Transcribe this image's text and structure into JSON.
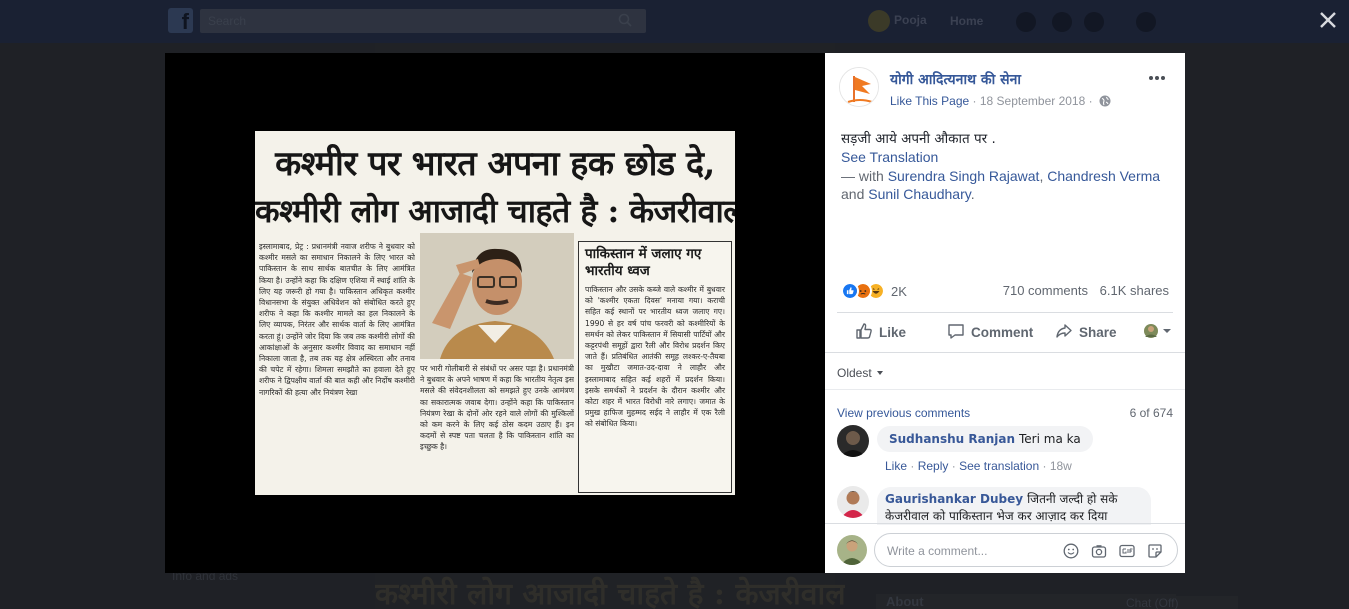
{
  "background": {
    "search_placeholder": "Search",
    "user_name": "Pooja",
    "home_label": "Home",
    "headline_bottom": "कश्मीरी लोग आजादी चाहते है : केजरीवाल",
    "left_snippet": "Info and ads",
    "about_label": "About",
    "chat_label": "Chat (Off)"
  },
  "photo": {
    "headline_line1": "कश्मीर पर भारत अपना हक छोड दे,",
    "headline_line2": "कश्मीरी लोग आजादी चाहते है : केजरीवाल",
    "col1_text": "इस्लामाबाद, प्रेट्र : प्रधानमंत्री नवाज शरीफ ने बुधवार को कश्मीर मसले का समाधान निकालने के लिए भारत को पाकिस्तान के साथ सार्थक बातचीत के लिए आमंत्रित किया है। उन्होंने कहा कि दक्षिण एशिया में स्थाई शांति के लिए यह जरूरी हो गया है। पाकिस्तान अधिकृत कश्मीर विधानसभा के संयुक्त अधिवेशन को संबोधित करते हुए शरीफ ने कहा कि कश्मीर मामले का हल निकालने के लिए व्यापक, निरंतर और सार्थक वार्ता के लिए आमंत्रित करता हूं। उन्होंने जोर दिया कि जब तक कश्मीरी लोगों की आकांक्षाओं के अनुसार कश्मीर विवाद का समाधान नहीं निकाला जाता है, तब तक यह क्षेत्र अस्थिरता और तनाव की चपेट में रहेगा। शिमला समझौते का हवाला देते हुए शरीफ ने द्विपक्षीय वार्ता की बात कही और निर्दोष कश्मीरी नागरिकों की हत्या और नियंत्रण रेखा",
    "col2_text": "पर भारी गोलीबारी से संबंधों पर असर पड़ा है। प्रधानमंत्री ने बुधवार के अपने भाषण में कहा कि भारतीय नेतृत्व इस मसले की संवेदनशीलता को समझते हुए उनके आमंत्रण का सकारात्मक जवाब देगा। उन्होंने कहा कि पाकिस्तान नियंत्रण रेखा के दोनों ओर रहने वाले लोगों की मुश्किलों को कम करने के लिए कई ठोस कदम उठाए हैं। इन कदमों से स्पष्ट पता चलता है कि पाकिस्तान शांति का इच्छुक है।",
    "box_title": "पाकिस्तान में जलाए गए भारतीय ध्वज",
    "box_text": "पाकिस्तान और उसके कब्जे वाले कश्मीर में बुधवार को 'कश्मीर एकता दिवस' मनाया गया। कराची सहित कई स्थानों पर भारतीय ध्वज जलाए गए। 1990 से हर वर्ष पांच फरवरी को कश्मीरियों के समर्थन को लेकर पाकिस्तान में सियासी पार्टियों और कट्टरपंथी समूहों द्वारा रैली और विरोध प्रदर्शन किए जाते हैं। प्रतिबंधित आतंकी समूह लश्कर-ए-तैयबा का मुखौटा जमात-उद-दावा ने लाहौर और इस्लामाबाद सहित कई शहरों में प्रदर्शन किया। इसके समर्थकों ने प्रदर्शन के दौरान कश्मीर और कोटा शहर में भारत विरोधी नारे लगाए। जमात के प्रमुख हाफिज मुहम्मद सईद ने लाहौर में एक रैली को संबोधित किया।"
  },
  "post": {
    "page_name": "योगी आदित्यनाथ की सेना",
    "like_page": "Like This Page",
    "separator": "·",
    "date": "18 September 2018",
    "separator2": "·",
    "text": "सड़जी आये अपनी औकात पर .",
    "see_translation": "See Translation",
    "with_prefix": "— with",
    "tag1": "Surendra Singh Rajawat",
    "comma": ",",
    "tag2": "Chandresh Verma",
    "and_word": "and",
    "tag3": "Sunil Chaudhary",
    "period": ".",
    "reactions_count": "2K",
    "comments_count": "710 comments",
    "shares_count": "6.1K shares",
    "reaction_colors": {
      "like": "#1877f2",
      "angry": "#e9710f",
      "haha": "#f7b125"
    }
  },
  "actions": {
    "like": "Like",
    "comment": "Comment",
    "share": "Share"
  },
  "comments": {
    "sort_label": "Oldest",
    "view_previous": "View previous comments",
    "pager": "6 of 674",
    "items": [
      {
        "name": "Sudhanshu Ranjan",
        "text": "Teri ma ka",
        "like": "Like",
        "reply": "Reply",
        "see_translation": "See translation",
        "dot": "·",
        "time": "18w"
      },
      {
        "name": "Gaurishankar Dubey",
        "text_line1": "जितनी जल्दी हो सके",
        "text_line2": "केजरीवाल को पाकिस्तान भेज कर आज़ाद कर दिया"
      }
    ],
    "composer_placeholder": "Write a comment..."
  }
}
